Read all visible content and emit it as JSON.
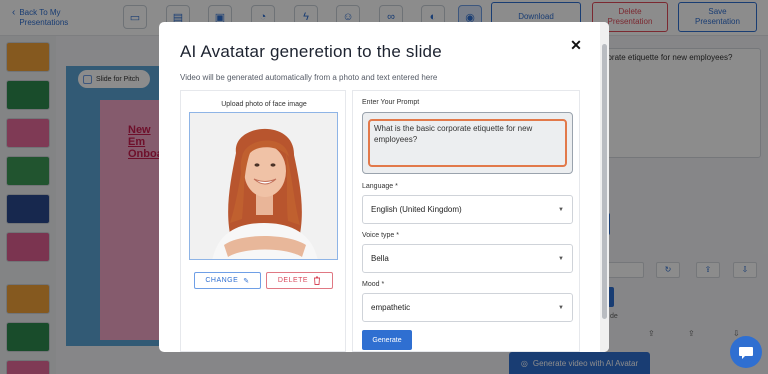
{
  "topbar": {
    "back_label": "Back To My Presentations",
    "download_label": "Download",
    "delete_label": "Delete Presentation",
    "save_label": "Save Presentation"
  },
  "editor": {
    "slide_for_pitch": "Slide for Pitch",
    "slide_title": "New Em Onboa",
    "right_prompt": "porate etiquette for new employees?",
    "right_small": "de",
    "generate_avatar_label": "Generate video with AI Avatar"
  },
  "modal": {
    "title": "AI Avatatar generetion to the slide",
    "subtitle": "Video will be generated automatically from a photo and text entered here",
    "upload_label": "Upload photo of face image",
    "change_label": "CHANGE",
    "delete_label": "DELETE",
    "prompt_label": "Enter Your Prompt",
    "prompt_value": "What is the basic corporate etiquette for new employees?",
    "language_label": "Language *",
    "language_value": "English (United Kingdom)",
    "voice_label": "Voice type *",
    "voice_value": "Bella",
    "mood_label": "Mood *",
    "mood_value": "empathetic",
    "generate_label": "Generate"
  },
  "icons": {
    "close": "close-icon",
    "pencil": "pencil-icon",
    "trash": "trash-icon",
    "caret": "chevron-down-icon",
    "chat": "chat-icon"
  },
  "colors": {
    "accent": "#2f6fd1",
    "danger": "#d8485a",
    "prompt_focus": "#e2794a"
  }
}
